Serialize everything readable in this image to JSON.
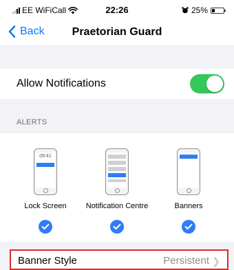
{
  "status_bar": {
    "carrier": "EE WiFiCall",
    "time": "22:26",
    "battery_percent_label": "25%",
    "battery_level": 0.25,
    "icons": [
      "signal-bars-icon",
      "wifi-icon",
      "alarm-icon",
      "battery-icon"
    ]
  },
  "nav": {
    "back_label": "Back",
    "title": "Praetorian Guard"
  },
  "allow_notifications": {
    "label": "Allow Notifications",
    "enabled": true
  },
  "alerts": {
    "header": "ALERTS",
    "options": [
      {
        "label": "Lock Screen",
        "preview_time": "09:41",
        "checked": true
      },
      {
        "label": "Notification Centre",
        "checked": true
      },
      {
        "label": "Banners",
        "checked": true
      }
    ]
  },
  "banner_style": {
    "label": "Banner Style",
    "value": "Persistent"
  },
  "colors": {
    "accent": "#0a7aff",
    "toggle_on": "#34c759",
    "check_blue": "#2f7cf6",
    "highlight_border": "#e0262d",
    "background": "#f2f2f7"
  }
}
